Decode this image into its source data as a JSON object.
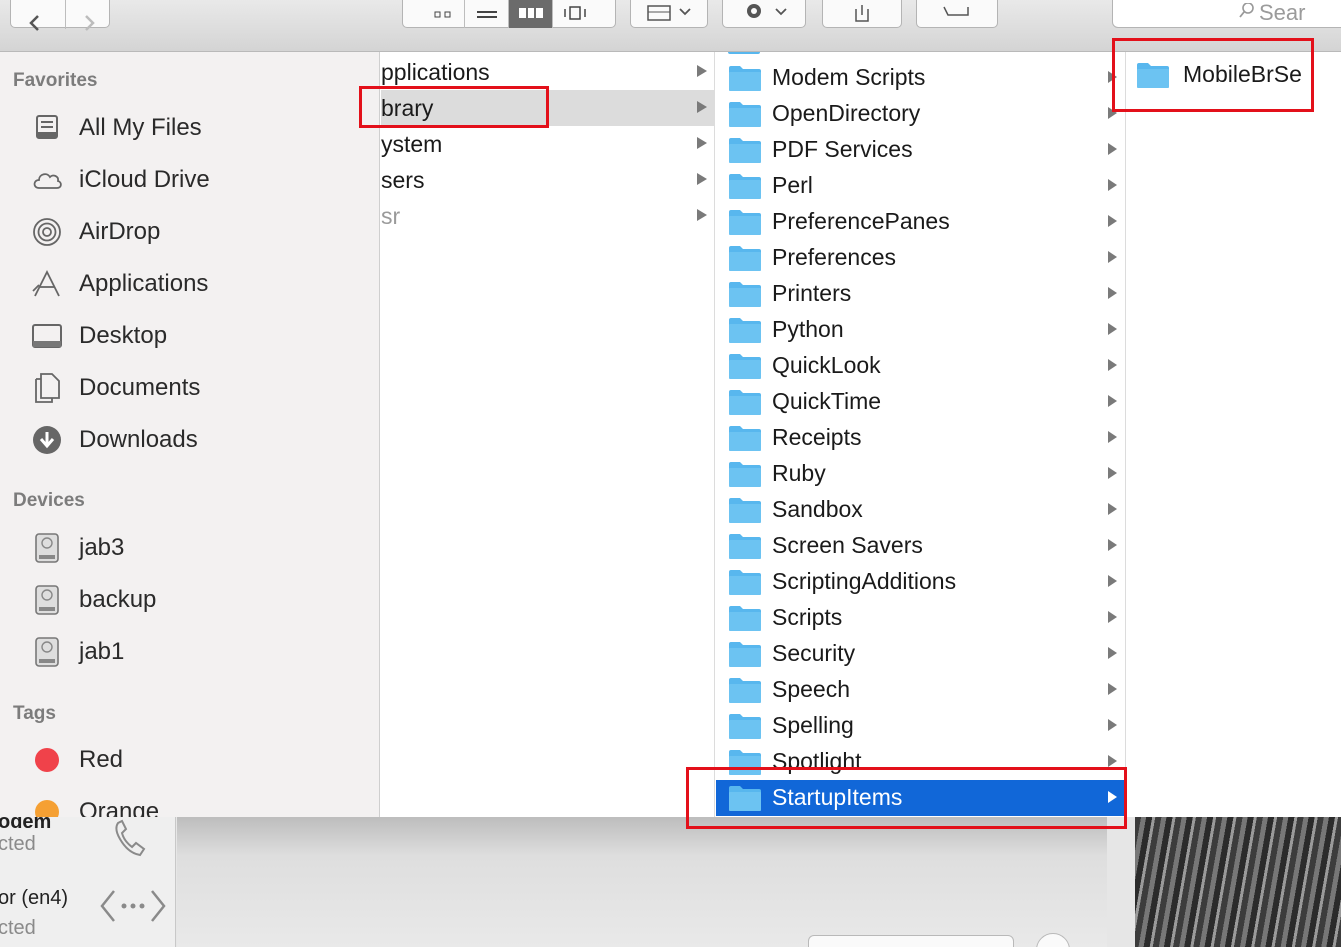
{
  "toolbar": {
    "search_placeholder": "Sear"
  },
  "sidebar": {
    "sections": {
      "favorites": "Favorites",
      "devices": "Devices",
      "tags": "Tags"
    },
    "favorites": [
      {
        "label": "All My Files",
        "icon": "all-files-icon"
      },
      {
        "label": "iCloud Drive",
        "icon": "cloud-icon"
      },
      {
        "label": "AirDrop",
        "icon": "airdrop-icon"
      },
      {
        "label": "Applications",
        "icon": "applications-icon"
      },
      {
        "label": "Desktop",
        "icon": "desktop-icon"
      },
      {
        "label": "Documents",
        "icon": "documents-icon"
      },
      {
        "label": "Downloads",
        "icon": "downloads-icon"
      }
    ],
    "devices": [
      {
        "label": "jab3",
        "icon": "disk-icon"
      },
      {
        "label": "backup",
        "icon": "disk-icon"
      },
      {
        "label": "jab1",
        "icon": "disk-icon"
      }
    ],
    "tags": [
      {
        "label": "Red",
        "color": "#f0424a"
      },
      {
        "label": "Orange",
        "color": "#f5a033"
      }
    ]
  },
  "column1": {
    "items": [
      {
        "label": "pplications"
      },
      {
        "label": "brary",
        "selected": true
      },
      {
        "label": "ystem"
      },
      {
        "label": "sers"
      },
      {
        "label": "sr"
      }
    ]
  },
  "column2": {
    "items": [
      "Modem Scripts",
      "OpenDirectory",
      "PDF Services",
      "Perl",
      "PreferencePanes",
      "Preferences",
      "Printers",
      "Python",
      "QuickLook",
      "QuickTime",
      "Receipts",
      "Ruby",
      "Sandbox",
      "Screen Savers",
      "ScriptingAdditions",
      "Scripts",
      "Security",
      "Speech",
      "Spelling",
      "Spotlight",
      "StartupItems"
    ],
    "selected": "StartupItems"
  },
  "column3": {
    "items": [
      "MobileBrSe"
    ]
  },
  "background_window": {
    "row1_title": "odem",
    "row1_status": "cted",
    "row2_title": "or (en4)",
    "row2_status": "cted"
  },
  "colors": {
    "selection_blue": "#1167d8",
    "folder_blue": "#58b7ee",
    "annotation_red": "#e3101a"
  }
}
